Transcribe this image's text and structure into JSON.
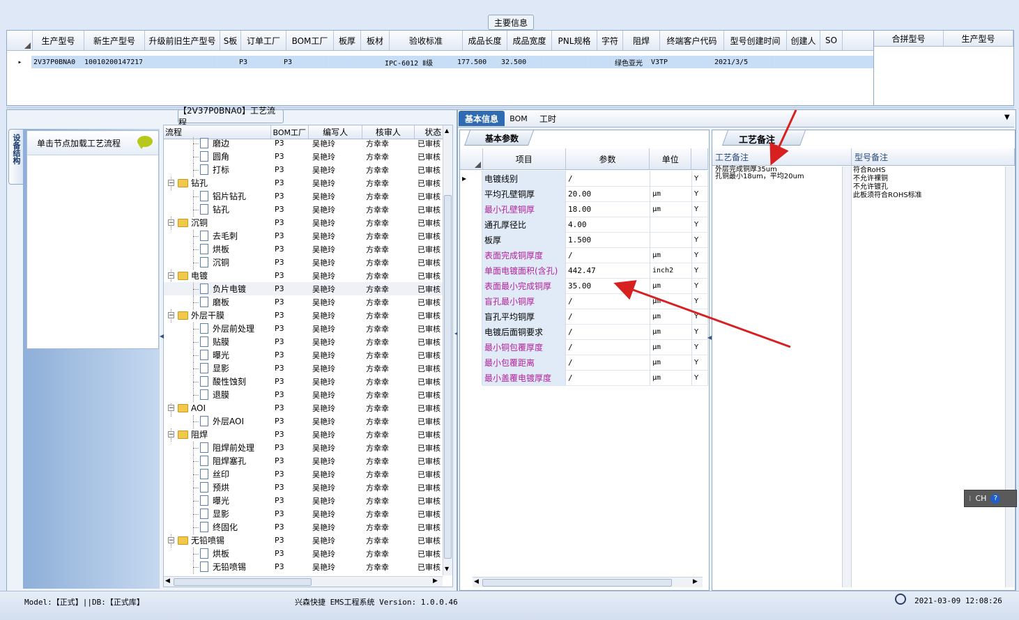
{
  "main_info": {
    "group_title": "主要信息",
    "columns": [
      "生产型号",
      "新生产型号",
      "升级前旧生产型号",
      "S板",
      "订单工厂",
      "BOM工厂",
      "板厚",
      "板材",
      "验收标准",
      "成品长度",
      "成品宽度",
      "PNL规格",
      "字符",
      "阻焊",
      "终端客户代码",
      "型号创建时间",
      "创建人",
      "SO"
    ],
    "row": [
      "2V37P0BNA0",
      "10010200147217",
      "",
      "",
      "P3",
      "P3",
      "",
      "",
      "IPC-6012 Ⅱ级",
      "177.500",
      "32.500",
      "",
      "",
      "绿色亚光",
      "V3TP",
      "2021/3/5",
      "",
      ""
    ],
    "side_columns": [
      "合拼型号",
      "生产型号"
    ]
  },
  "flow_panel": {
    "title": "【2V37P0BNA0】工艺流程",
    "vertical_tab": "设备结构",
    "hint_text": "单击节点加载工艺流程",
    "columns": [
      "流程",
      "BOM工厂",
      "编写人",
      "核审人",
      "状态"
    ],
    "rows": [
      {
        "name": "磨边",
        "level": 2,
        "folder": false,
        "bom": "P3",
        "writer": "吴艳玲",
        "reviewer": "方幸幸",
        "status": "已审核"
      },
      {
        "name": "圆角",
        "level": 2,
        "folder": false,
        "bom": "P3",
        "writer": "吴艳玲",
        "reviewer": "方幸幸",
        "status": "已审核"
      },
      {
        "name": "打标",
        "level": 2,
        "folder": false,
        "bom": "P3",
        "writer": "吴艳玲",
        "reviewer": "方幸幸",
        "status": "已审核"
      },
      {
        "name": "钻孔",
        "level": 1,
        "folder": true,
        "bom": "P3",
        "writer": "吴艳玲",
        "reviewer": "方幸幸",
        "status": "已审核"
      },
      {
        "name": "铝片钻孔",
        "level": 2,
        "folder": false,
        "bom": "P3",
        "writer": "吴艳玲",
        "reviewer": "方幸幸",
        "status": "已审核"
      },
      {
        "name": "钻孔",
        "level": 2,
        "folder": false,
        "bom": "P3",
        "writer": "吴艳玲",
        "reviewer": "方幸幸",
        "status": "已审核"
      },
      {
        "name": "沉铜",
        "level": 1,
        "folder": true,
        "bom": "P3",
        "writer": "吴艳玲",
        "reviewer": "方幸幸",
        "status": "已审核"
      },
      {
        "name": "去毛刺",
        "level": 2,
        "folder": false,
        "bom": "P3",
        "writer": "吴艳玲",
        "reviewer": "方幸幸",
        "status": "已审核"
      },
      {
        "name": "烘板",
        "level": 2,
        "folder": false,
        "bom": "P3",
        "writer": "吴艳玲",
        "reviewer": "方幸幸",
        "status": "已审核"
      },
      {
        "name": "沉铜",
        "level": 2,
        "folder": false,
        "bom": "P3",
        "writer": "吴艳玲",
        "reviewer": "方幸幸",
        "status": "已审核"
      },
      {
        "name": "电镀",
        "level": 1,
        "folder": true,
        "bom": "P3",
        "writer": "吴艳玲",
        "reviewer": "方幸幸",
        "status": "已审核"
      },
      {
        "name": "负片电镀",
        "level": 2,
        "folder": false,
        "bom": "P3",
        "writer": "吴艳玲",
        "reviewer": "方幸幸",
        "status": "已审核"
      },
      {
        "name": "磨板",
        "level": 2,
        "folder": false,
        "bom": "P3",
        "writer": "吴艳玲",
        "reviewer": "方幸幸",
        "status": "已审核"
      },
      {
        "name": "外层干膜",
        "level": 1,
        "folder": true,
        "bom": "P3",
        "writer": "吴艳玲",
        "reviewer": "方幸幸",
        "status": "已审核"
      },
      {
        "name": "外层前处理",
        "level": 2,
        "folder": false,
        "bom": "P3",
        "writer": "吴艳玲",
        "reviewer": "方幸幸",
        "status": "已审核"
      },
      {
        "name": "贴膜",
        "level": 2,
        "folder": false,
        "bom": "P3",
        "writer": "吴艳玲",
        "reviewer": "方幸幸",
        "status": "已审核"
      },
      {
        "name": "曝光",
        "level": 2,
        "folder": false,
        "bom": "P3",
        "writer": "吴艳玲",
        "reviewer": "方幸幸",
        "status": "已审核"
      },
      {
        "name": "显影",
        "level": 2,
        "folder": false,
        "bom": "P3",
        "writer": "吴艳玲",
        "reviewer": "方幸幸",
        "status": "已审核"
      },
      {
        "name": "酸性蚀刻",
        "level": 2,
        "folder": false,
        "bom": "P3",
        "writer": "吴艳玲",
        "reviewer": "方幸幸",
        "status": "已审核"
      },
      {
        "name": "退膜",
        "level": 2,
        "folder": false,
        "bom": "P3",
        "writer": "吴艳玲",
        "reviewer": "方幸幸",
        "status": "已审核"
      },
      {
        "name": "AOI",
        "level": 1,
        "folder": true,
        "bom": "P3",
        "writer": "吴艳玲",
        "reviewer": "方幸幸",
        "status": "已审核"
      },
      {
        "name": "外层AOI",
        "level": 2,
        "folder": false,
        "bom": "P3",
        "writer": "吴艳玲",
        "reviewer": "方幸幸",
        "status": "已审核"
      },
      {
        "name": "阻焊",
        "level": 1,
        "folder": true,
        "bom": "P3",
        "writer": "吴艳玲",
        "reviewer": "方幸幸",
        "status": "已审核"
      },
      {
        "name": "阻焊前处理",
        "level": 2,
        "folder": false,
        "bom": "P3",
        "writer": "吴艳玲",
        "reviewer": "方幸幸",
        "status": "已审核"
      },
      {
        "name": "阻焊塞孔",
        "level": 2,
        "folder": false,
        "bom": "P3",
        "writer": "吴艳玲",
        "reviewer": "方幸幸",
        "status": "已审核"
      },
      {
        "name": "丝印",
        "level": 2,
        "folder": false,
        "bom": "P3",
        "writer": "吴艳玲",
        "reviewer": "方幸幸",
        "status": "已审核"
      },
      {
        "name": "预烘",
        "level": 2,
        "folder": false,
        "bom": "P3",
        "writer": "吴艳玲",
        "reviewer": "方幸幸",
        "status": "已审核"
      },
      {
        "name": "曝光",
        "level": 2,
        "folder": false,
        "bom": "P3",
        "writer": "吴艳玲",
        "reviewer": "方幸幸",
        "status": "已审核"
      },
      {
        "name": "显影",
        "level": 2,
        "folder": false,
        "bom": "P3",
        "writer": "吴艳玲",
        "reviewer": "方幸幸",
        "status": "已审核"
      },
      {
        "name": "终固化",
        "level": 2,
        "folder": false,
        "bom": "P3",
        "writer": "吴艳玲",
        "reviewer": "方幸幸",
        "status": "已审核"
      },
      {
        "name": "无铅喷锡",
        "level": 1,
        "folder": true,
        "bom": "P3",
        "writer": "吴艳玲",
        "reviewer": "方幸幸",
        "status": "已审核"
      },
      {
        "name": "烘板",
        "level": 2,
        "folder": false,
        "bom": "P3",
        "writer": "吴艳玲",
        "reviewer": "方幸幸",
        "status": "已审核"
      },
      {
        "name": "无铅喷锡",
        "level": 2,
        "folder": false,
        "bom": "P3",
        "writer": "吴艳玲",
        "reviewer": "方幸幸",
        "status": "已审核"
      }
    ],
    "selected_row": "负片电镀"
  },
  "tabs": [
    "基本信息",
    "BOM",
    "工时"
  ],
  "params": {
    "tab_label": "基本参数",
    "columns": [
      "项目",
      "参数",
      "单位"
    ],
    "rows": [
      {
        "item": "电镀线别",
        "value": "/",
        "unit": "",
        "flag": "Y",
        "highlight": false
      },
      {
        "item": "平均孔壁铜厚",
        "value": "20.00",
        "unit": "μm",
        "flag": "Y",
        "highlight": false
      },
      {
        "item": "最小孔壁铜厚",
        "value": "18.00",
        "unit": "μm",
        "flag": "Y",
        "highlight": true
      },
      {
        "item": "通孔厚径比",
        "value": "4.00",
        "unit": "",
        "flag": "Y",
        "highlight": false
      },
      {
        "item": "板厚",
        "value": "1.500",
        "unit": "",
        "flag": "Y",
        "highlight": false
      },
      {
        "item": "表面完成铜厚度",
        "value": "/",
        "unit": "μm",
        "flag": "Y",
        "highlight": true
      },
      {
        "item": "单面电镀面积(含孔)",
        "value": "442.47",
        "unit": "inch2",
        "flag": "Y",
        "highlight": true
      },
      {
        "item": "表面最小完成铜厚",
        "value": "35.00",
        "unit": "μm",
        "flag": "Y",
        "highlight": true
      },
      {
        "item": "盲孔最小铜厚",
        "value": "/",
        "unit": "μm",
        "flag": "Y",
        "highlight": true
      },
      {
        "item": "盲孔平均铜厚",
        "value": "/",
        "unit": "μm",
        "flag": "Y",
        "highlight": false
      },
      {
        "item": "电镀后面铜要求",
        "value": "/",
        "unit": "μm",
        "flag": "Y",
        "highlight": false
      },
      {
        "item": "最小铜包覆厚度",
        "value": "/",
        "unit": "μm",
        "flag": "Y",
        "highlight": true
      },
      {
        "item": "最小包覆距离",
        "value": "/",
        "unit": "μm",
        "flag": "Y",
        "highlight": true
      },
      {
        "item": "最小盖覆电镀厚度",
        "value": "/",
        "unit": "μm",
        "flag": "Y",
        "highlight": true
      }
    ]
  },
  "remarks": {
    "tab_label": "工艺备注",
    "col1_header": "工艺备注",
    "col2_header": "型号备注",
    "col1_lines": [
      "外层完成铜厚35um",
      "孔铜最小18um，平均20um"
    ],
    "col2_lines": [
      "符合RoHS",
      "不允许裸铜",
      "不允许镀孔",
      "此板须符合ROHS标准"
    ]
  },
  "ime": {
    "label": "CH"
  },
  "status_bar": {
    "left": "Model:【正式】||DB:【正式库】",
    "center": "兴森快捷 EMS工程系统 Version: 1.0.0.46",
    "right": "2021-03-09 12:08:26"
  },
  "colors": {
    "highlight_text": "#b0229a",
    "selection": "#c8ddf6",
    "arrow": "#d82020"
  }
}
